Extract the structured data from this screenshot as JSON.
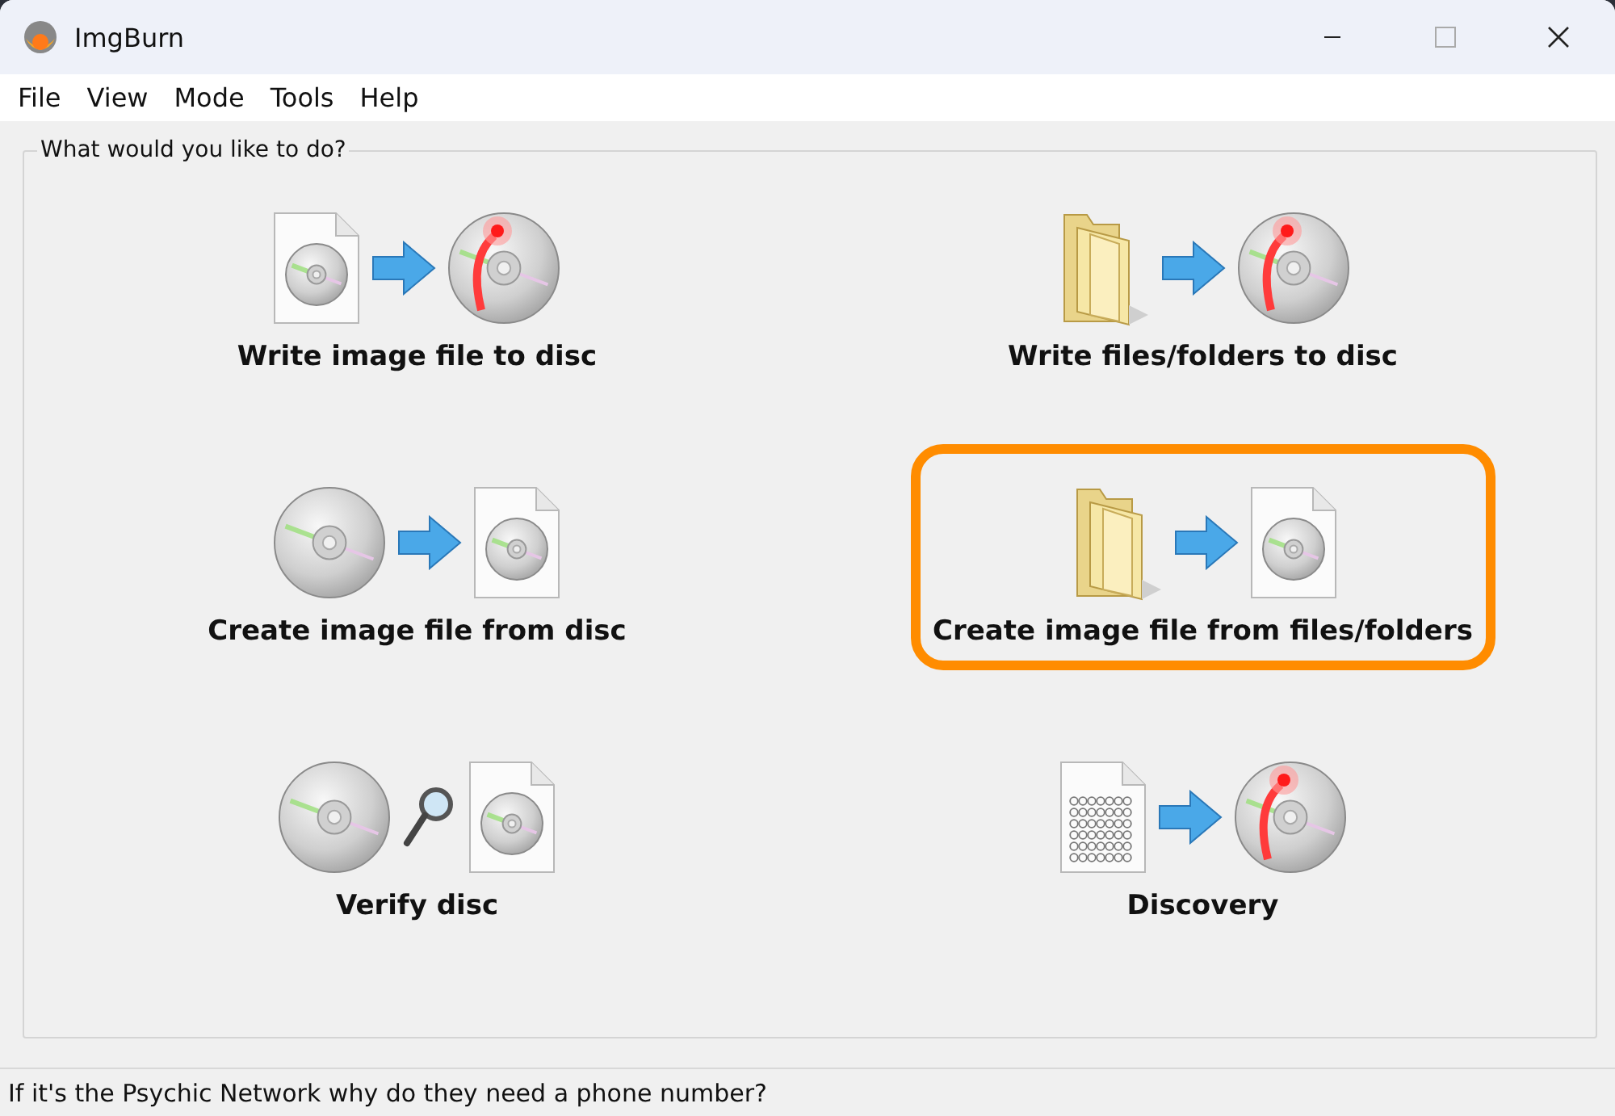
{
  "window": {
    "title": "ImgBurn"
  },
  "menu": [
    "File",
    "View",
    "Mode",
    "Tools",
    "Help"
  ],
  "group": {
    "title": "What would you like to do?"
  },
  "actions": [
    {
      "label": "Write image file to disc",
      "icons": [
        {
          "kind": "image-file"
        },
        {
          "kind": "arrow"
        },
        {
          "kind": "burning-disc"
        }
      ],
      "selected": false
    },
    {
      "label": "Write files/folders to disc",
      "icons": [
        {
          "kind": "folder"
        },
        {
          "kind": "arrow"
        },
        {
          "kind": "burning-disc"
        }
      ],
      "selected": false
    },
    {
      "label": "Create image file from disc",
      "icons": [
        {
          "kind": "disc"
        },
        {
          "kind": "arrow"
        },
        {
          "kind": "image-file"
        }
      ],
      "selected": false
    },
    {
      "label": "Create image file from files/folders",
      "icons": [
        {
          "kind": "folder"
        },
        {
          "kind": "arrow"
        },
        {
          "kind": "image-file"
        }
      ],
      "selected": true
    },
    {
      "label": "Verify disc",
      "icons": [
        {
          "kind": "disc"
        },
        {
          "kind": "magnifier"
        },
        {
          "kind": "image-file"
        }
      ],
      "selected": false
    },
    {
      "label": "Discovery",
      "icons": [
        {
          "kind": "data-file"
        },
        {
          "kind": "arrow"
        },
        {
          "kind": "burning-disc"
        }
      ],
      "selected": false
    }
  ],
  "status_bar": {
    "text": "If it's the Psychic Network why do they need a phone number?"
  }
}
